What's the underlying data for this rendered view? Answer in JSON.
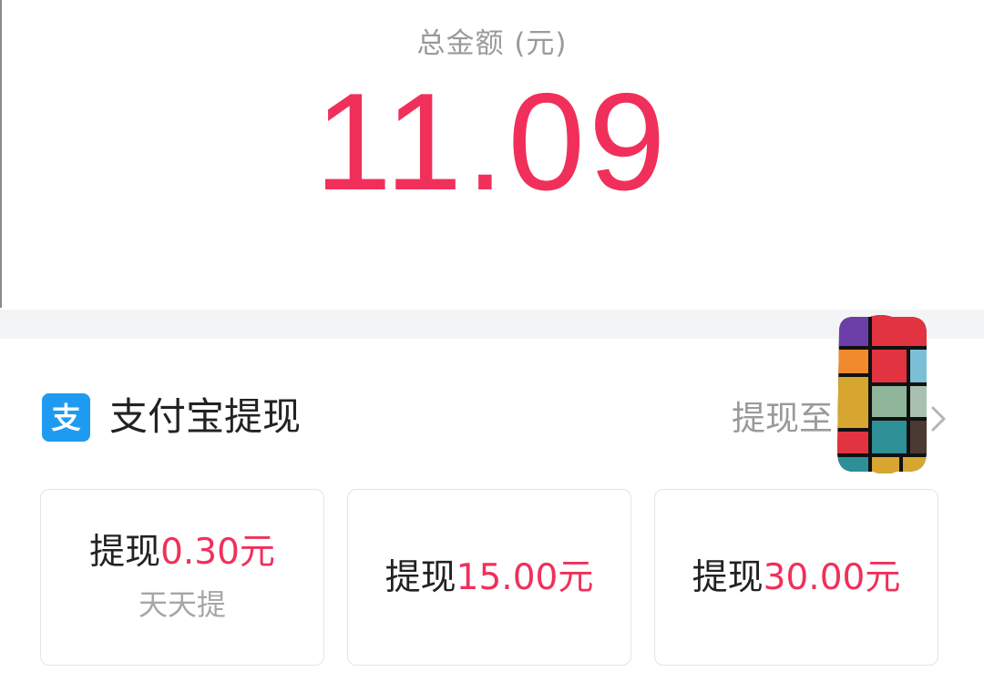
{
  "header": {
    "total_label": "总金额 (元)",
    "total_amount": "11.09"
  },
  "withdraw_section": {
    "icon": "alipay-icon",
    "title": "支付宝提现",
    "withdraw_to_label": "提现至"
  },
  "options": [
    {
      "prefix": "提现",
      "amount": "0.30元",
      "subtitle": "天天提"
    },
    {
      "prefix": "提现",
      "amount": "15.00元"
    },
    {
      "prefix": "提现",
      "amount": "30.00元"
    }
  ],
  "colors": {
    "accent": "#f0305a",
    "alipay_blue": "#1e9bf0",
    "muted_text": "#9a9a9a",
    "divider": "#f3f4f6"
  }
}
